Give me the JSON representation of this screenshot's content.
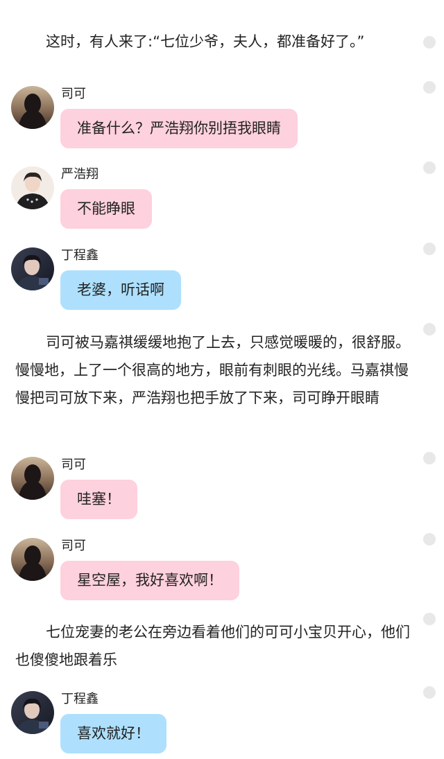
{
  "colors": {
    "pink_bubble": "#fdd1dd",
    "blue_bubble": "#aee0fd",
    "side_dot": "#e8e8e8"
  },
  "narration": [
    "这时，有人来了:“七位少爷，夫人，都准备好了。”",
    "司可被马嘉祺缓缓地抱了上去，只感觉暖暖的，很舒服。慢慢地，上了一个很高的地方，眼前有刺眼的光线。马嘉祺慢慢把司可放下来，严浩翔也把手放了下来，司可睁开眼睛",
    "七位宠妻的老公在旁边看着他们的可可小宝贝开心，他们也傻傻地跟着乐"
  ],
  "messages": [
    {
      "speaker": "司可",
      "text": "准备什么？严浩翔你别捂我眼睛",
      "bubble_color": "pink",
      "avatar": "sike-avatar"
    },
    {
      "speaker": "严浩翔",
      "text": "不能睁眼",
      "bubble_color": "pink",
      "avatar": "yanhaoxiang-avatar"
    },
    {
      "speaker": "丁程鑫",
      "text": "老婆，听话啊",
      "bubble_color": "blue",
      "avatar": "dingchengxin-avatar"
    },
    {
      "speaker": "司可",
      "text": "哇塞！",
      "bubble_color": "pink",
      "avatar": "sike-avatar"
    },
    {
      "speaker": "司可",
      "text": "星空屋，我好喜欢啊！",
      "bubble_color": "pink",
      "avatar": "sike-avatar"
    },
    {
      "speaker": "丁程鑫",
      "text": "喜欢就好！",
      "bubble_color": "blue",
      "avatar": "dingchengxin-avatar"
    }
  ]
}
